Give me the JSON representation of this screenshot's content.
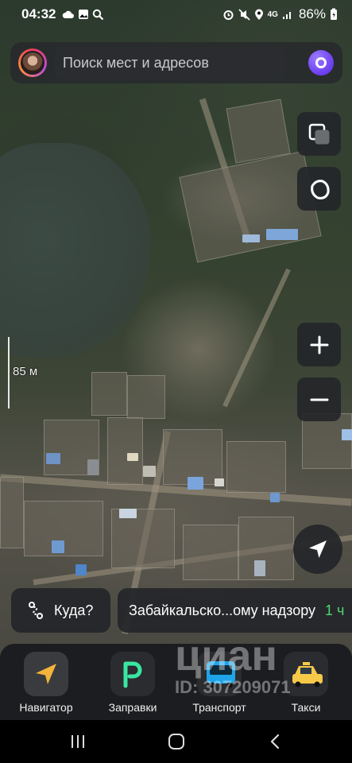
{
  "status_bar": {
    "time": "04:32",
    "battery": "86%",
    "network": "4G",
    "left_icons": [
      "cloud-icon",
      "image-icon",
      "search-icon"
    ],
    "right_icons": [
      "alarm-icon",
      "mute-icon",
      "location-icon",
      "signal-icon",
      "battery-icon"
    ]
  },
  "search": {
    "placeholder": "Поиск мест и адресов",
    "value": ""
  },
  "map": {
    "scale_label": "85 м",
    "controls": [
      "layers-icon",
      "tilt-3d-icon",
      "zoom-in-icon",
      "zoom-out-icon",
      "locate-me-icon"
    ]
  },
  "chips": {
    "where_label": "Куда?",
    "route_label": "Забайкальско...ому надзору",
    "route_time": "1 ч"
  },
  "tray": {
    "apps": [
      {
        "label": "Навигатор"
      },
      {
        "label": "Заправки"
      },
      {
        "label": "Транспорт"
      },
      {
        "label": "Такси"
      }
    ]
  },
  "watermark": {
    "brand": "циан",
    "id": "ID: 307209071"
  },
  "colors": {
    "accent_green": "#4fd873",
    "alice_purple": "#6b3df0",
    "panel": "#242629"
  }
}
